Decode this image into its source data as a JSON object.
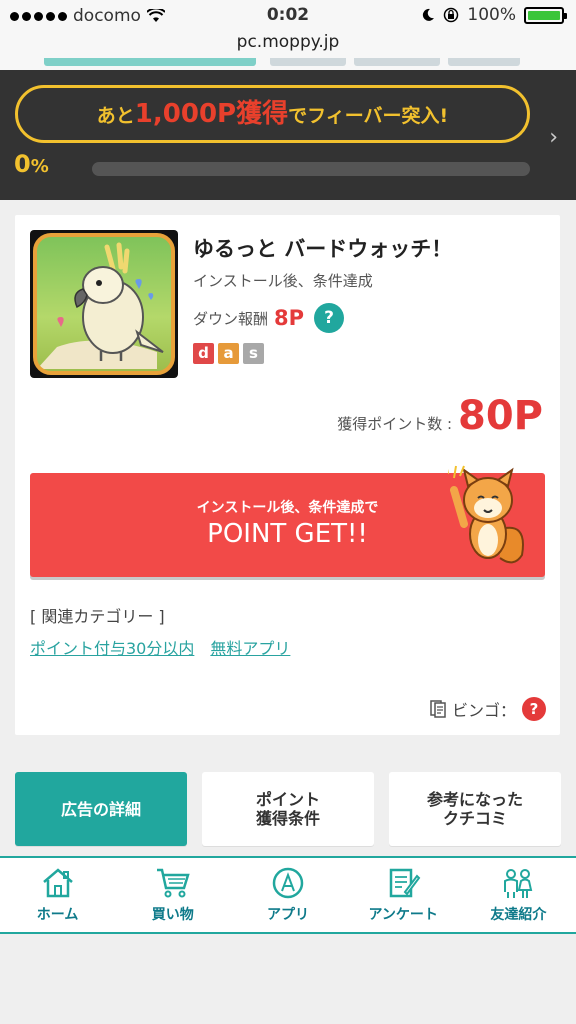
{
  "status_bar": {
    "carrier": "docomo",
    "time": "0:02",
    "battery": "100%"
  },
  "url": "pc.moppy.jp",
  "fever": {
    "prefix": "あと",
    "amount": "1,000P獲得",
    "suffix": "でフィーバー突入!",
    "percent": "0",
    "percent_unit": "%",
    "progress": 0
  },
  "offer": {
    "title": "ゆるっと バードウォッチ！",
    "subtitle": "インストール後、条件達成",
    "down_label": "ダウン報酬",
    "down_points": "8P",
    "help": "?",
    "badges": [
      {
        "letter": "d",
        "color": "#e04848"
      },
      {
        "letter": "a",
        "color": "#e69a3a"
      },
      {
        "letter": "s",
        "color": "#a8a8a8"
      }
    ],
    "get_label": "獲得ポイント数 :",
    "get_value": "80P"
  },
  "point_button": {
    "sub": "インストール後、条件達成で",
    "main": "POINT GET!!"
  },
  "related": {
    "title": "[ 関連カテゴリー ]",
    "links": [
      "ポイント付与30分以内",
      "無料アプリ"
    ]
  },
  "bingo": {
    "label": "ビンゴ：",
    "help": "?"
  },
  "tabs": [
    "広告の詳細",
    "ポイント\n獲得条件",
    "参考になった\nクチコミ"
  ],
  "nav": [
    {
      "label": "ホーム",
      "icon": "home-icon"
    },
    {
      "label": "買い物",
      "icon": "cart-icon"
    },
    {
      "label": "アプリ",
      "icon": "app-icon"
    },
    {
      "label": "アンケート",
      "icon": "survey-icon"
    },
    {
      "label": "友達紹介",
      "icon": "friends-icon"
    }
  ],
  "colors": {
    "accent": "#21a79e",
    "red": "#e43a3a",
    "gold": "#f2c12e",
    "banner_bg": "#333333"
  }
}
